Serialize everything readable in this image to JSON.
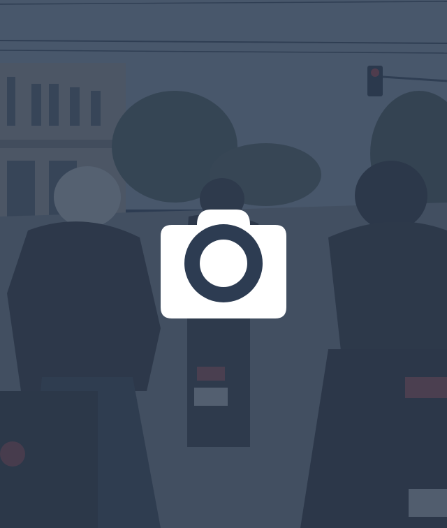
{
  "photo_preview": {
    "subject": "motorcyclists-at-intersection",
    "overlay_color": "#2d3c52",
    "icon": "camera-icon",
    "icon_color": "#ffffff"
  }
}
